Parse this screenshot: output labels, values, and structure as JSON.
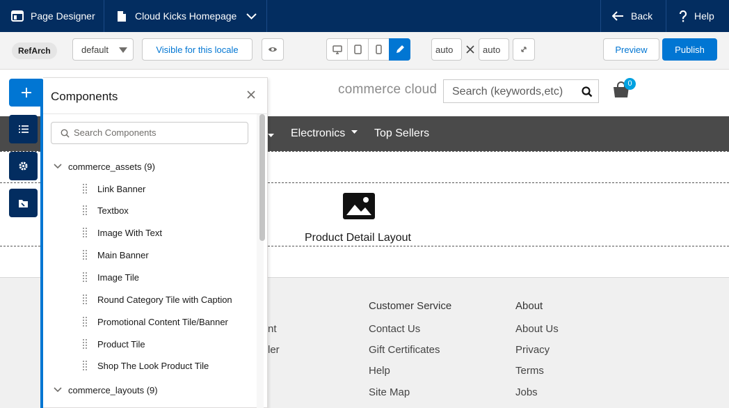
{
  "topbar": {
    "app_title": "Page Designer",
    "page_name": "Cloud Kicks Homepage",
    "back_label": "Back",
    "help_label": "Help"
  },
  "toolbar": {
    "site_badge": "RefArch",
    "locale_value": "default",
    "visibility_label": "Visible for this locale",
    "width_value": "auto",
    "height_value": "auto",
    "preview_label": "Preview",
    "publish_label": "Publish"
  },
  "site": {
    "logo_text": "commerce cloud",
    "search_placeholder": "Search (keywords,etc)",
    "cart_count": "0",
    "nav": [
      "Electronics",
      "Top Sellers"
    ],
    "layout_label": "Product Detail Layout",
    "footer": {
      "col1_links": [
        "nt",
        "ler"
      ],
      "col2_heading": "Customer Service",
      "col2_links": [
        "Contact Us",
        "Gift Certificates",
        "Help",
        "Site Map"
      ],
      "col3_heading": "About",
      "col3_links": [
        "About Us",
        "Privacy",
        "Terms",
        "Jobs"
      ]
    }
  },
  "panel": {
    "title": "Components",
    "search_placeholder": "Search Components",
    "groups": [
      {
        "name": "commerce_assets (9)",
        "items": [
          "Link Banner",
          "Textbox",
          "Image With Text",
          "Main Banner",
          "Image Tile",
          "Round Category Tile with Caption",
          "Promotional Content Tile/Banner",
          "Product Tile",
          "Shop The Look Product Tile"
        ]
      },
      {
        "name": "commerce_layouts (9)",
        "items": []
      }
    ]
  },
  "colors": {
    "topbar": "#032d60",
    "brand": "#0176d3",
    "site_nav": "#4a4a4a",
    "cart_badge": "#00a1e0"
  }
}
